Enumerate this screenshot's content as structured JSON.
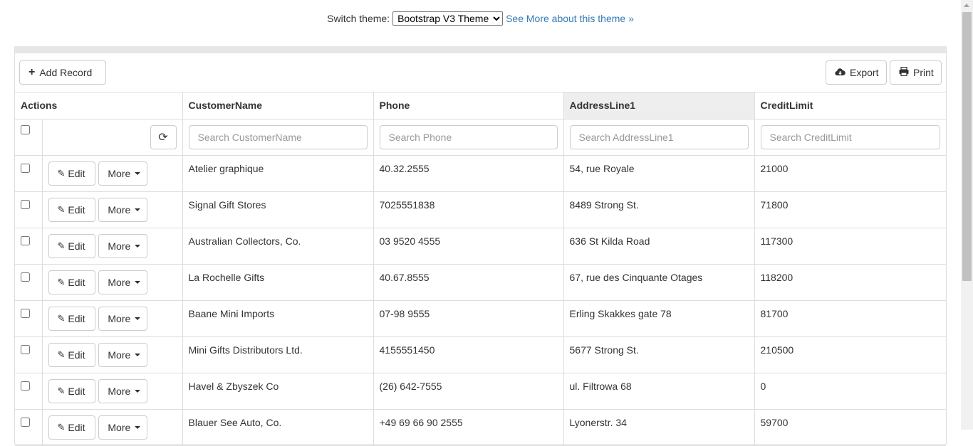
{
  "theme_bar": {
    "label": "Switch theme:",
    "selected": "Bootstrap V3 Theme",
    "link": "See More about this theme »"
  },
  "toolbar": {
    "add_label": "Add Record",
    "export_label": "Export",
    "print_label": "Print"
  },
  "columns": {
    "actions": "Actions",
    "customer": "CustomerName",
    "phone": "Phone",
    "address": "AddressLine1",
    "credit": "CreditLimit"
  },
  "filters": {
    "customer_placeholder": "Search CustomerName",
    "phone_placeholder": "Search Phone",
    "address_placeholder": "Search AddressLine1",
    "credit_placeholder": "Search CreditLimit"
  },
  "row_actions": {
    "edit": "Edit",
    "more": "More"
  },
  "rows": [
    {
      "customer": "Atelier graphique",
      "phone": "40.32.2555",
      "address": "54, rue Royale",
      "credit": "21000"
    },
    {
      "customer": "Signal Gift Stores",
      "phone": "7025551838",
      "address": "8489 Strong St.",
      "credit": "71800"
    },
    {
      "customer": "Australian Collectors, Co.",
      "phone": "03 9520 4555",
      "address": "636 St Kilda Road",
      "credit": "117300"
    },
    {
      "customer": "La Rochelle Gifts",
      "phone": "40.67.8555",
      "address": "67, rue des Cinquante Otages",
      "credit": "118200"
    },
    {
      "customer": "Baane Mini Imports",
      "phone": "07-98 9555",
      "address": "Erling Skakkes gate 78",
      "credit": "81700"
    },
    {
      "customer": "Mini Gifts Distributors Ltd.",
      "phone": "4155551450",
      "address": "5677 Strong St.",
      "credit": "210500"
    },
    {
      "customer": "Havel & Zbyszek Co",
      "phone": "(26) 642-7555",
      "address": "ul. Filtrowa 68",
      "credit": "0"
    },
    {
      "customer": "Blauer See Auto, Co.",
      "phone": "+49 69 66 90 2555",
      "address": "Lyonerstr. 34",
      "credit": "59700"
    }
  ]
}
